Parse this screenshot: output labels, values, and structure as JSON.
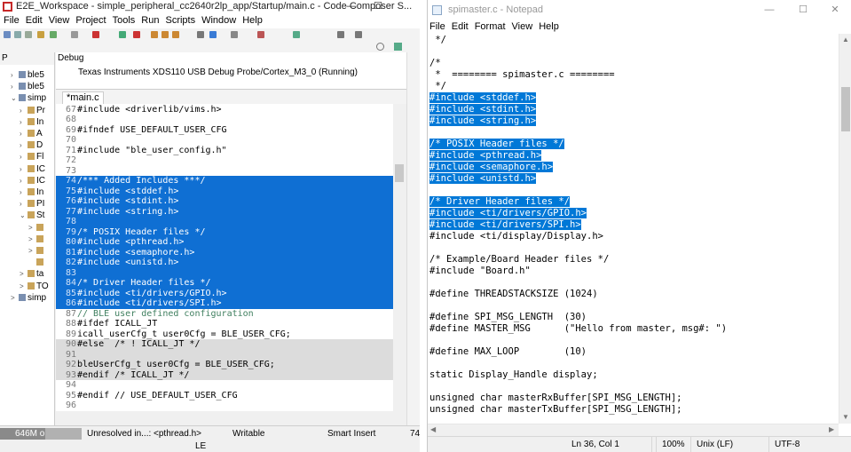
{
  "ccs": {
    "title": "E2E_Workspace - simple_peripheral_cc2640r2lp_app/Startup/main.c - Code Composer S...",
    "window_controls": [
      "—",
      "☐"
    ],
    "menu": [
      "File",
      "Edit",
      "View",
      "Project",
      "Tools",
      "Run",
      "Scripts",
      "Window",
      "Help"
    ],
    "project_panel": {
      "tab_label": "P",
      "items": [
        {
          "label": "ble5",
          "arrow": "›"
        },
        {
          "label": "ble5",
          "arrow": "›"
        },
        {
          "label": "simp",
          "arrow": "⌄"
        },
        {
          "label": "Pr",
          "arrow": "›"
        },
        {
          "label": "In",
          "arrow": "›"
        },
        {
          "label": "A",
          "arrow": "›"
        },
        {
          "label": "D",
          "arrow": "›"
        },
        {
          "label": "Fl",
          "arrow": "›"
        },
        {
          "label": "IC",
          "arrow": "›"
        },
        {
          "label": "IC",
          "arrow": "›"
        },
        {
          "label": "In",
          "arrow": "›"
        },
        {
          "label": "PI",
          "arrow": "›"
        },
        {
          "label": "St",
          "arrow": "⌄"
        },
        {
          "label": "",
          "arrow": ">"
        },
        {
          "label": "",
          "arrow": ">"
        },
        {
          "label": "",
          "arrow": ">"
        },
        {
          "label": "",
          "arrow": ""
        },
        {
          "label": "ta",
          "arrow": ">"
        },
        {
          "label": "TO",
          "arrow": ">"
        },
        {
          "label": "simp",
          "arrow": ">"
        }
      ]
    },
    "debug": {
      "tab": "Debug",
      "line": "Texas Instruments XDS110 USB Debug Probe/Cortex_M3_0 (Running)"
    },
    "editor_tab": "*main.c",
    "code_lines": [
      {
        "n": "67",
        "t": "#include <driverlib/vims.h>",
        "s": 0
      },
      {
        "n": "68",
        "t": "",
        "s": 0
      },
      {
        "n": "69",
        "t": "#ifndef USE_DEFAULT_USER_CFG",
        "s": 0
      },
      {
        "n": "70",
        "t": "",
        "s": 0
      },
      {
        "n": "71",
        "t": "#include \"ble_user_config.h\"",
        "s": 0
      },
      {
        "n": "72",
        "t": "",
        "s": 0
      },
      {
        "n": "73",
        "t": "",
        "s": 0
      },
      {
        "n": "74",
        "t": "/*** Added Includes ***/",
        "s": 1
      },
      {
        "n": "75",
        "t": "#include <stddef.h>",
        "s": 1
      },
      {
        "n": "76",
        "t": "#include <stdint.h>",
        "s": 1
      },
      {
        "n": "77",
        "t": "#include <string.h>",
        "s": 1
      },
      {
        "n": "78",
        "t": "",
        "s": 1
      },
      {
        "n": "79",
        "t": "/* POSIX Header files */",
        "s": 1
      },
      {
        "n": "80",
        "t": "#include <pthread.h>",
        "s": 1
      },
      {
        "n": "81",
        "t": "#include <semaphore.h>",
        "s": 1
      },
      {
        "n": "82",
        "t": "#include <unistd.h>",
        "s": 1
      },
      {
        "n": "83",
        "t": "",
        "s": 1
      },
      {
        "n": "84",
        "t": "/* Driver Header files */",
        "s": 1
      },
      {
        "n": "85",
        "t": "#include <ti/drivers/GPIO.h>",
        "s": 1
      },
      {
        "n": "86",
        "t": "#include <ti/drivers/SPI.h>",
        "s": 1
      },
      {
        "n": "87",
        "t": "// BLE user defined configuration",
        "s": 0
      },
      {
        "n": "88",
        "t": "#ifdef ICALL_JT",
        "s": 0
      },
      {
        "n": "89",
        "t": "icall_userCfg_t user0Cfg = BLE_USER_CFG;",
        "s": 0
      },
      {
        "n": "90",
        "t": "#else  /* ! ICALL_JT */",
        "s": 2
      },
      {
        "n": "91",
        "t": "",
        "s": 2
      },
      {
        "n": "92",
        "t": "bleUserCfg_t user0Cfg = BLE_USER_CFG;",
        "s": 2
      },
      {
        "n": "93",
        "t": "#endif /* ICALL_JT */",
        "s": 2
      },
      {
        "n": "94",
        "t": "",
        "s": 0
      },
      {
        "n": "95",
        "t": "#endif // USE_DEFAULT_USER_CFG",
        "s": 0
      },
      {
        "n": "96",
        "t": "",
        "s": 0
      }
    ],
    "status": {
      "memory": "646M o",
      "memory_fraction": 0.55,
      "unresolved": "Unresolved in...: <pthread.h>",
      "writable": "Writable",
      "insert_mode": "Smart Insert",
      "position": "74",
      "encoding": "LE"
    }
  },
  "notepad": {
    "title": "spimaster.c - Notepad",
    "window_controls": [
      "—",
      "☐",
      "✕"
    ],
    "menu": [
      "File",
      "Edit",
      "Format",
      "View",
      "Help"
    ],
    "lines": [
      {
        "t": " */",
        "h": 0
      },
      {
        "t": "",
        "h": 0
      },
      {
        "t": "/*",
        "h": 0
      },
      {
        "t": " *  ======== spimaster.c ========",
        "h": 0
      },
      {
        "t": " */",
        "h": 0
      },
      {
        "t": "#include <stddef.h>",
        "h": 1
      },
      {
        "t": "#include <stdint.h>",
        "h": 1
      },
      {
        "t": "#include <string.h>",
        "h": 1
      },
      {
        "t": "",
        "h": 0
      },
      {
        "t": "/* POSIX Header files */",
        "h": 1
      },
      {
        "t": "#include <pthread.h>",
        "h": 1
      },
      {
        "t": "#include <semaphore.h>",
        "h": 1
      },
      {
        "t": "#include <unistd.h>",
        "h": 1
      },
      {
        "t": "",
        "h": 0
      },
      {
        "t": "/* Driver Header files */",
        "h": 1
      },
      {
        "t": "#include <ti/drivers/GPIO.h>",
        "h": 1
      },
      {
        "t": "#include <ti/drivers/SPI.h>",
        "h": 1
      },
      {
        "t": "#include <ti/display/Display.h>",
        "h": 0
      },
      {
        "t": "",
        "h": 0
      },
      {
        "t": "/* Example/Board Header files */",
        "h": 0
      },
      {
        "t": "#include \"Board.h\"",
        "h": 0
      },
      {
        "t": "",
        "h": 0
      },
      {
        "t": "#define THREADSTACKSIZE (1024)",
        "h": 0
      },
      {
        "t": "",
        "h": 0
      },
      {
        "t": "#define SPI_MSG_LENGTH  (30)",
        "h": 0
      },
      {
        "t": "#define MASTER_MSG      (\"Hello from master, msg#: \")",
        "h": 0
      },
      {
        "t": "",
        "h": 0
      },
      {
        "t": "#define MAX_LOOP        (10)",
        "h": 0
      },
      {
        "t": "",
        "h": 0
      },
      {
        "t": "static Display_Handle display;",
        "h": 0
      },
      {
        "t": "",
        "h": 0
      },
      {
        "t": "unsigned char masterRxBuffer[SPI_MSG_LENGTH];",
        "h": 0
      },
      {
        "t": "unsigned char masterTxBuffer[SPI_MSG_LENGTH];",
        "h": 0
      }
    ],
    "status": {
      "cursor": "Ln 36, Col 1",
      "zoom": "100%",
      "line_endings": "Unix (LF)",
      "encoding": "UTF-8"
    }
  },
  "colors": {
    "ccs_selection": "#0f6fd3",
    "notepad_selection": "#0078d7",
    "inactive_block": "#dcdcdc"
  }
}
